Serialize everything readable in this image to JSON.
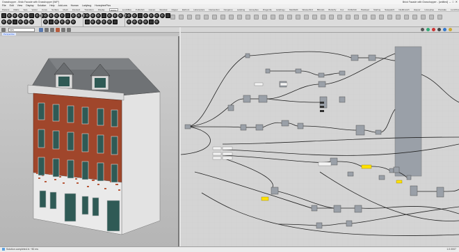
{
  "titlebar": {
    "app": "Grasshopper - Brick Facade with Grasshopper [WIP]",
    "doc": "Brick Facade with Grasshopper - [untitled]",
    "min": "–",
    "max": "□",
    "close": "✕"
  },
  "menu": [
    "File",
    "Edit",
    "View",
    "Display",
    "Solution",
    "Help",
    "Add-ons",
    "Human",
    "Ladybug",
    "HoneybeePlus"
  ],
  "ribbon_tabs": [
    "Params",
    "Maths",
    "Sets",
    "Vector",
    "Curve",
    "Surface",
    "Mesh",
    "Intersect",
    "Transform",
    "Display",
    "Extra",
    "LunchBox",
    "Pufferfish",
    "Human",
    "Wombat",
    "Clipper",
    "Elefront",
    "Heteroptera",
    "Intersection",
    "Kangaroo",
    "Ladybug",
    "Honeybee",
    "Dragonfly",
    "Ladybug+",
    "MeshEdit",
    "Weaverbird",
    "Bifocals",
    "Butterfly",
    "Fox",
    "Pufferfish",
    "Parakeet",
    "Starling",
    "Sasquatch",
    "Nudibranch",
    "Hopper",
    "Honeybee",
    "Pancake",
    "Lunchbox",
    "Conduit",
    "Zebra",
    "Anemone",
    "TT Toolbox",
    "Fox",
    "Metahopper",
    "Hops",
    "Kiwi!3D",
    "Lobster",
    "Squid",
    "Bowerbird",
    "Wasp",
    "Owl",
    "Leafvein",
    "Human UI",
    "Shapediver",
    "Elk",
    "Ghowl",
    "Synapse",
    "Clipper"
  ],
  "ribbon_active": "Extra",
  "toolbar_groups": [
    "Geometry",
    "Primitive",
    "Input",
    "Util",
    "Geometry",
    "Primitive",
    "Input",
    "Util"
  ],
  "rhino_field": "SRS",
  "viewport_label": "Perspective",
  "status": "Solution completed in ~50 ms",
  "status_right": "1.0.0007",
  "colors": {
    "brick": "#a0462b",
    "plaster": "#eaeaea",
    "roof": "#6f7275",
    "window": "#2f5a55",
    "slider": "#ffe100",
    "group": "#9aa0a8"
  }
}
